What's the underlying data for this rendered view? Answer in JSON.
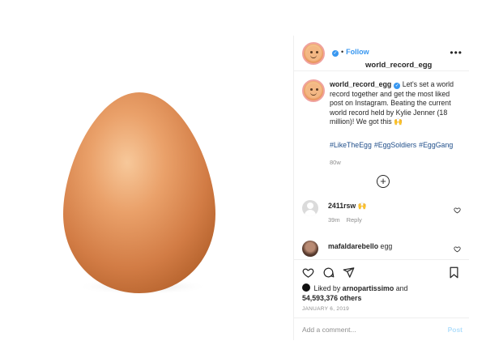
{
  "post": {
    "image_alt_icon": "egg-photo",
    "colors": {
      "accent": "#3897f0",
      "muted": "#8e8e8e",
      "border": "#efefef",
      "hashtag": "#00376b"
    }
  },
  "header": {
    "username": "world_record_egg",
    "separator": "•",
    "follow_label": "Follow",
    "more_label": "•••"
  },
  "caption": {
    "username": "world_record_egg",
    "text": "Let's set a world record together and get the most liked post on Instagram. Beating the current world record held by Kylie Jenner (18 million)! We got this 🙌",
    "hashtags": [
      "#LikeTheEgg",
      "#EggSoldiers",
      "#EggGang"
    ],
    "time": "80w",
    "load_more_icon": "plus-circle-icon"
  },
  "comments": [
    {
      "username": "2411rsw",
      "text": "🙌",
      "time": "39m",
      "reply_label": "Reply"
    },
    {
      "username": "mafaldarebello",
      "text": "egg"
    }
  ],
  "actions": {
    "icons": [
      "heart-icon",
      "comment-icon",
      "share-icon",
      "bookmark-icon"
    ]
  },
  "likes": {
    "prefix": "Liked by",
    "user": "arnopartissimo",
    "conjunction": "and",
    "count": "54,593,376 others"
  },
  "date": "JANUARY 6, 2019",
  "add_comment": {
    "placeholder": "Add a comment...",
    "post_label": "Post"
  }
}
